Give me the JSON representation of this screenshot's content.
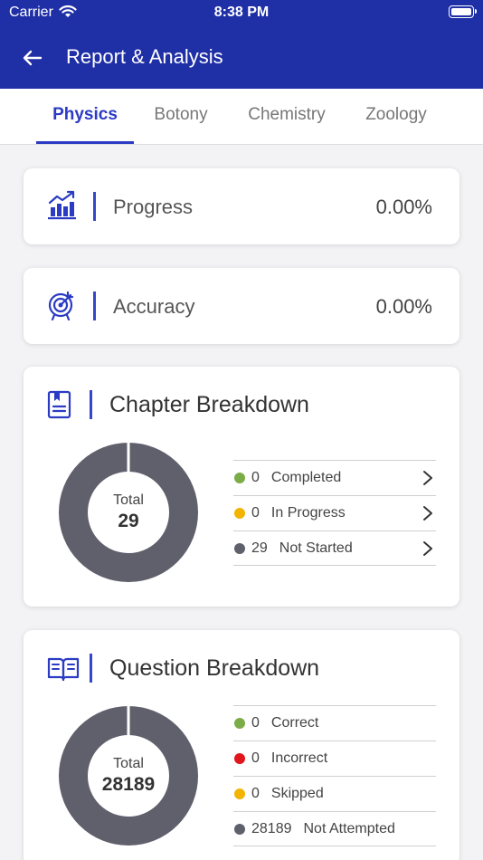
{
  "status_bar": {
    "carrier": "Carrier",
    "time": "8:38 PM"
  },
  "header": {
    "title": "Report & Analysis"
  },
  "tabs": [
    {
      "label": "Physics",
      "active": true
    },
    {
      "label": "Botony",
      "active": false
    },
    {
      "label": "Chemistry",
      "active": false
    },
    {
      "label": "Zoology",
      "active": false
    }
  ],
  "progress": {
    "label": "Progress",
    "value": "0.00%"
  },
  "accuracy": {
    "label": "Accuracy",
    "value": "0.00%"
  },
  "chapter": {
    "title": "Chapter Breakdown",
    "total_label": "Total",
    "total": "29",
    "items": [
      {
        "count": "0",
        "label": "Completed",
        "color": "#7cac48"
      },
      {
        "count": "0",
        "label": "In Progress",
        "color": "#f2b400"
      },
      {
        "count": "29",
        "label": "Not Started",
        "color": "#5f606c"
      }
    ]
  },
  "question": {
    "title": "Question Breakdown",
    "total_label": "Total",
    "total": "28189",
    "items": [
      {
        "count": "0",
        "label": "Correct",
        "color": "#7cac48"
      },
      {
        "count": "0",
        "label": "Incorrect",
        "color": "#e0161c"
      },
      {
        "count": "0",
        "label": "Skipped",
        "color": "#f2b400"
      },
      {
        "count": "28189",
        "label": "Not Attempted",
        "color": "#5f606c"
      }
    ]
  },
  "colors": {
    "header": "#1f2fa6",
    "accent": "#2b3bc4",
    "donut": "#5f606c"
  }
}
